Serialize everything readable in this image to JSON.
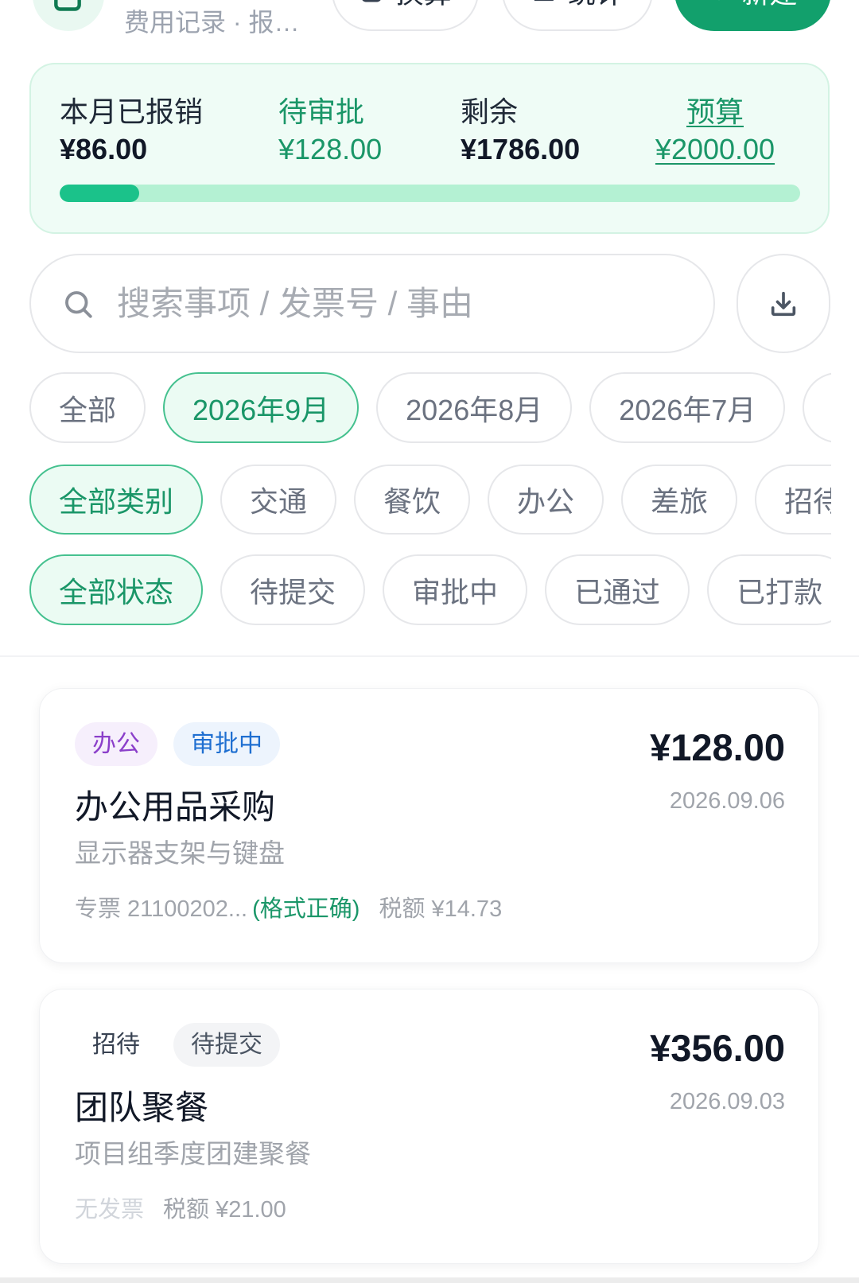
{
  "colors": {
    "primary": "#12a06c",
    "primary_text": "#1a9668",
    "primary_soft": "#ebfbf3",
    "primary_border": "#45c18f",
    "summary_bg": "#effcf6",
    "summary_border": "#d3f3e3",
    "progress_fill": "#1bc28a",
    "progress_track": "#b4f1d3"
  },
  "header": {
    "logo_icon": "clipboard-icon",
    "subtitle": "费用记录 · 报…",
    "actions": [
      {
        "label": "换算",
        "icon": "calculator-icon"
      },
      {
        "label": "统计",
        "icon": "bar-chart-icon"
      },
      {
        "label": "新建",
        "icon": "plus-icon"
      }
    ]
  },
  "summary": {
    "reimbursed": {
      "label": "本月已报销",
      "value": "¥86.00"
    },
    "pending": {
      "label": "待审批",
      "value": "¥128.00"
    },
    "remaining": {
      "label": "剩余",
      "value": "¥1786.00"
    },
    "budget": {
      "label": "预算",
      "value": "¥2000.00"
    },
    "progress": 0.107
  },
  "search": {
    "placeholder": "搜索事项 / 发票号 / 事由",
    "icon": "search-icon"
  },
  "export": {
    "icon": "download-icon"
  },
  "filters": {
    "months": {
      "options": [
        "全部",
        "2026年9月",
        "2026年8月",
        "2026年7月"
      ],
      "selected_index": 1
    },
    "categories": {
      "options": [
        "全部类别",
        "交通",
        "餐饮",
        "办公",
        "差旅",
        "招待"
      ],
      "selected_index": 0
    },
    "statuses": {
      "options": [
        "全部状态",
        "待提交",
        "审批中",
        "已通过",
        "已打款"
      ],
      "selected_index": 0
    }
  },
  "records": [
    {
      "category": {
        "text": "办公",
        "color": "#8b3fca",
        "bg": "#f6effc"
      },
      "status": {
        "text": "审批中",
        "color": "#1f6fd1",
        "bg": "#edf4fd"
      },
      "title": "办公用品采购",
      "description": "显示器支架与键盘",
      "invoice": "专票 21100202...",
      "invoice_color": "#a0a4ab",
      "invoice_check": "(格式正确)",
      "tax": "税额 ¥14.73",
      "amount": "¥128.00",
      "date": "2026.09.06"
    },
    {
      "category": {
        "text": "招待",
        "color": "#374151",
        "bg": "#ffffff"
      },
      "status": {
        "text": "待提交",
        "color": "#4b5563",
        "bg": "#f3f4f6"
      },
      "title": "团队聚餐",
      "description": "项目组季度团建聚餐",
      "invoice": "无发票",
      "invoice_color": "#d1d5db",
      "tax": "税额 ¥21.00",
      "amount": "¥356.00",
      "date": "2026.09.03"
    }
  ]
}
